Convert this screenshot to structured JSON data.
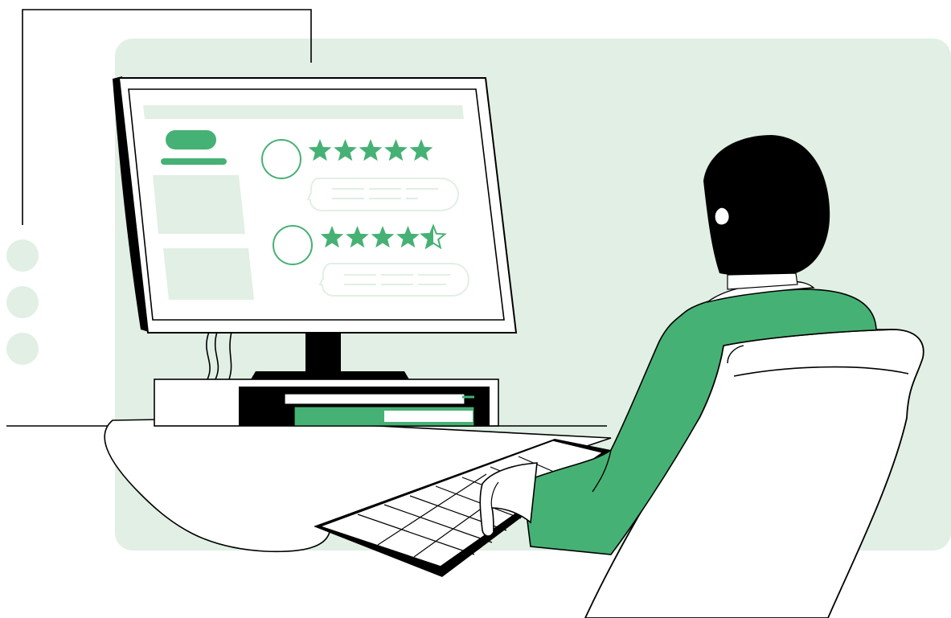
{
  "colors": {
    "accent_green": "#46b174",
    "panel_light_green": "#e1efe4",
    "outline_black": "#000000",
    "background": "#ffffff"
  },
  "screen": {
    "reviews": [
      {
        "rating": 5
      },
      {
        "rating": 4.5
      }
    ]
  },
  "icons": [
    "star-icon",
    "half-star-icon",
    "avatar-circle-icon",
    "speech-bubble-icon",
    "dot-icon"
  ]
}
